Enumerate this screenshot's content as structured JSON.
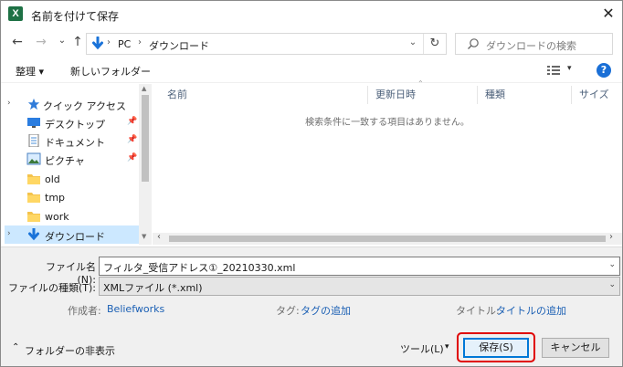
{
  "window": {
    "title": "名前を付けて保存",
    "app_icon": "excel-icon",
    "close_glyph": "✕"
  },
  "nav": {
    "back_glyph": "←",
    "forward_glyph": "→",
    "recent_glyph": "⌄",
    "up_glyph": "↑",
    "breadcrumb": [
      "PC",
      "ダウンロード"
    ],
    "breadcrumb_sep": "›",
    "dropdown_glyph": "⌄",
    "refresh_glyph": "↻",
    "search_placeholder": "ダウンロードの検索"
  },
  "toolbar": {
    "organize_label": "整理 ▾",
    "new_folder_label": "新しいフォルダー",
    "view_dd_glyph": "▾",
    "help_glyph": "?"
  },
  "sidebar": {
    "items": [
      {
        "label": "クイック アクセス",
        "icon": "star-icon",
        "chevron": "›",
        "pinned": false,
        "selected": false
      },
      {
        "label": "デスクトップ",
        "icon": "desktop-icon",
        "chevron": "",
        "pinned": true,
        "selected": false
      },
      {
        "label": "ドキュメント",
        "icon": "document-icon",
        "chevron": "",
        "pinned": true,
        "selected": false
      },
      {
        "label": "ピクチャ",
        "icon": "picture-icon",
        "chevron": "",
        "pinned": true,
        "selected": false
      },
      {
        "label": "old",
        "icon": "folder-icon",
        "chevron": "",
        "pinned": false,
        "selected": false
      },
      {
        "label": "tmp",
        "icon": "folder-icon",
        "chevron": "",
        "pinned": false,
        "selected": false
      },
      {
        "label": "work",
        "icon": "folder-icon",
        "chevron": "",
        "pinned": false,
        "selected": false
      },
      {
        "label": "ダウンロード",
        "icon": "download-icon",
        "chevron": "›",
        "pinned": false,
        "selected": true
      }
    ],
    "pin_glyph": "📌"
  },
  "filelist": {
    "columns": [
      "名前",
      "更新日時",
      "種類",
      "サイズ"
    ],
    "sort_glyph": "⌃",
    "empty_message": "検索条件に一致する項目はありません。"
  },
  "form": {
    "filename_label": "ファイル名(N):",
    "filename_value": "フィルタ_受信アドレス①_20210330.xml",
    "filetype_label": "ファイルの種類(T):",
    "filetype_value": "XMLファイル (*.xml)",
    "author_label": "作成者:",
    "author_value": "Beliefworks",
    "tags_label": "タグ:",
    "tags_value": "タグの追加",
    "title_label": "タイトル:",
    "title_value": "タイトルの追加"
  },
  "footer": {
    "hide_folders_label": "フォルダーの非表示",
    "hide_chevron": "⌃",
    "tools_label": "ツール(L)",
    "tools_dd": "▾",
    "save_label": "保存(S)",
    "cancel_label": "キャンセル"
  },
  "colors": {
    "accent": "#0078d7",
    "highlight_ring": "#e00000",
    "selected_bg": "#cce8ff",
    "link": "#1a5fb4"
  }
}
